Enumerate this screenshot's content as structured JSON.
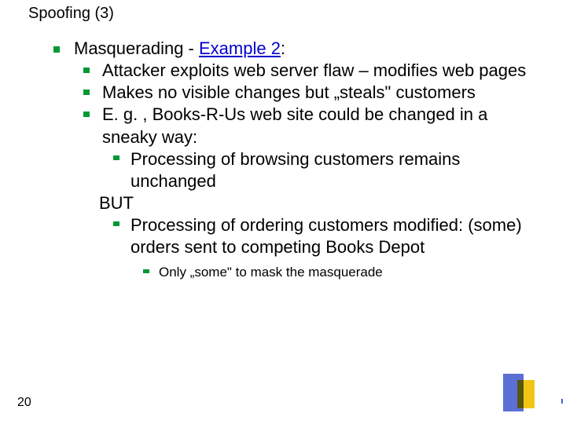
{
  "title": "Spoofing (3)",
  "l1_prefix": "Masquerading - ",
  "l1_link": "Example 2",
  "l1_suffix": ":",
  "l2_a": "Attacker exploits web server flaw – modifies web pages",
  "l2_b": "Makes no visible changes but „steals\" customers",
  "l2_c": "E. g. , Books-R-Us web site could be changed in a sneaky way:",
  "l3_a": "Processing of browsing customers remains unchanged",
  "but": "BUT",
  "l3_b": "Processing of ordering customers modified: (some) orders sent to competing Books Depot",
  "l4_a": "Only „some\" to mask the masquerade",
  "slide_number": "20"
}
